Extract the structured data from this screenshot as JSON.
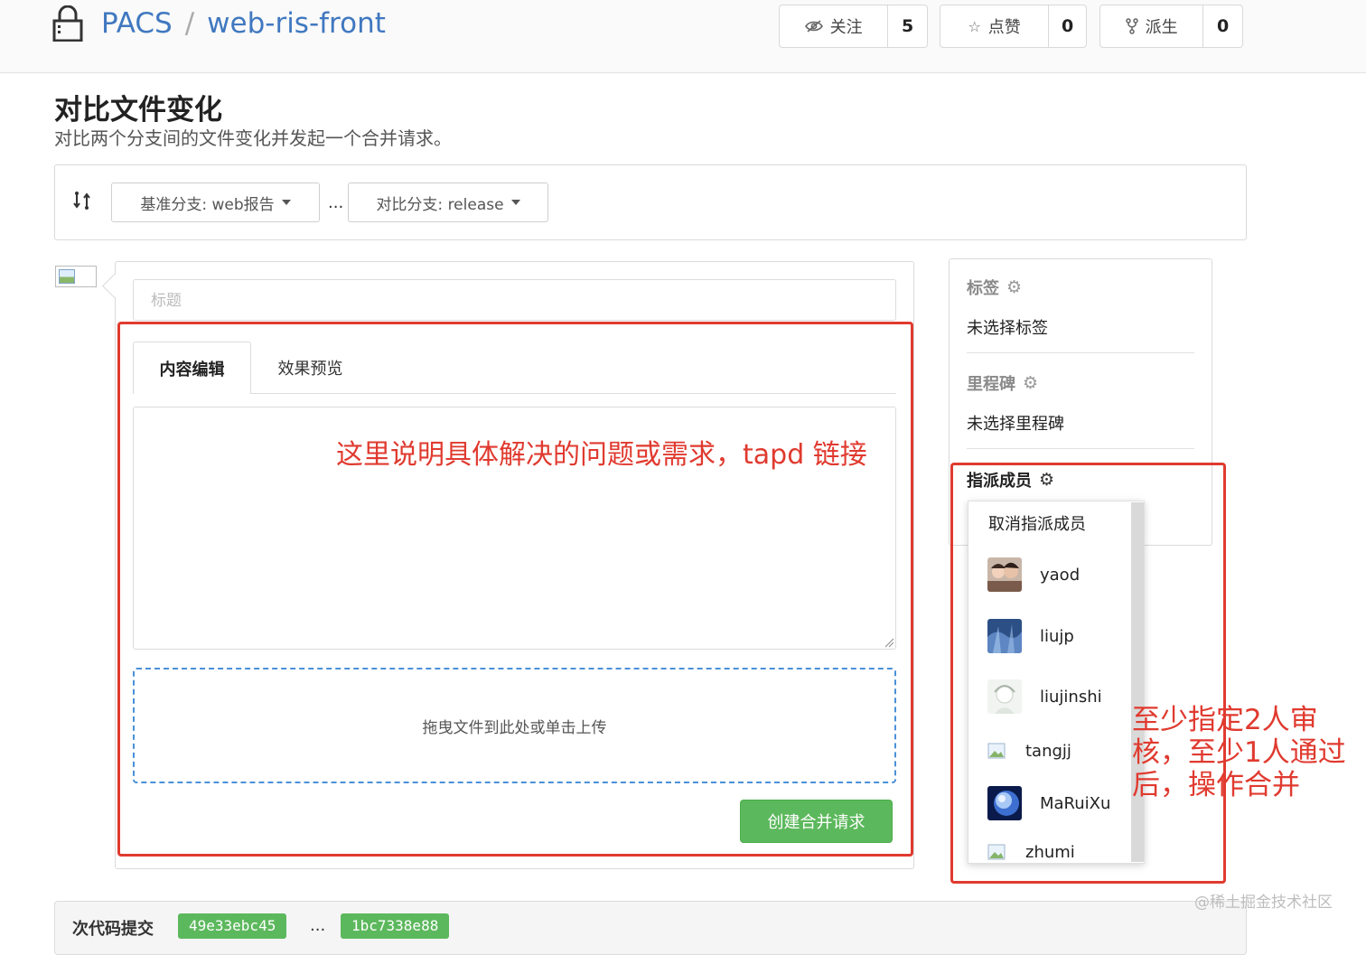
{
  "header": {
    "org": "PACS",
    "separator": "/",
    "repo": "web-ris-front",
    "watch": {
      "label": "关注",
      "count": "5",
      "icon": "eye-slash-icon"
    },
    "star": {
      "label": "点赞",
      "count": "0",
      "icon": "star-icon"
    },
    "fork": {
      "label": "派生",
      "count": "0",
      "icon": "fork-icon"
    }
  },
  "page": {
    "title": "对比文件变化",
    "description": "对比两个分支间的文件变化并发起一个合并请求。"
  },
  "branches": {
    "base": "基准分支: web报告",
    "separator": "...",
    "compare": "对比分支: release"
  },
  "form": {
    "title_placeholder": "标题",
    "tabs": [
      "内容编辑",
      "效果预览"
    ],
    "upload_hint": "拖曳文件到此处或单击上传",
    "submit_label": "创建合并请求"
  },
  "annotations": {
    "content_note": "这里说明具体解决的问题或需求，tapd 链接",
    "reviewer_note": "至少指定2人审核，至少1人通过后，操作合并"
  },
  "sidebar": {
    "labels": {
      "heading": "标签",
      "value": "未选择标签"
    },
    "milestone": {
      "heading": "里程碑",
      "value": "未选择里程碑"
    },
    "assignees": {
      "heading": "指派成员"
    }
  },
  "assignee_dropdown": {
    "cancel": "取消指派成员",
    "users": [
      {
        "name": "yaod",
        "avatar": "photo"
      },
      {
        "name": "liujp",
        "avatar": "photo"
      },
      {
        "name": "liujinshi",
        "avatar": "photo"
      },
      {
        "name": "tangjj",
        "avatar": "broken"
      },
      {
        "name": "MaRuiXu",
        "avatar": "photo"
      },
      {
        "name": "zhumi",
        "avatar": "broken"
      }
    ]
  },
  "commits": {
    "label": "次代码提交",
    "from_sha": "49e33ebc45",
    "separator": "...",
    "to_sha": "1bc7338e88"
  },
  "watermark": "@稀土掘金技术社区",
  "colors": {
    "link": "#4078c0",
    "primary_green": "#5cb85c",
    "annotation_red": "#e03a2f",
    "upload_border": "#4a90d9"
  }
}
